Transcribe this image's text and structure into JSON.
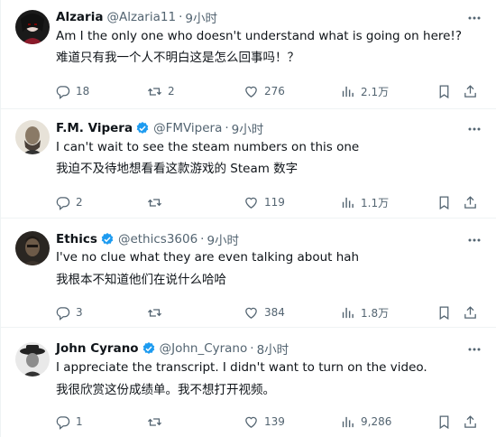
{
  "tweets": [
    {
      "name": "Alzaria",
      "handle": "@Alzaria11",
      "dot": "·",
      "time": "9小时",
      "verified": false,
      "line1": "Am I the only one who doesn't understand what is going on here!?",
      "line2": "难道只有我一个人不明白这是怎么回事吗！？",
      "replies": "18",
      "retweets": "2",
      "likes": "276",
      "views": "2.1万"
    },
    {
      "name": "F.M. Vipera",
      "handle": "@FMVipera",
      "dot": "·",
      "time": "9小时",
      "verified": true,
      "line1": "I can't wait to see the steam numbers on this one",
      "line2": "我迫不及待地想看看这款游戏的 Steam 数字",
      "replies": "2",
      "retweets": "",
      "likes": "119",
      "views": "1.1万"
    },
    {
      "name": "Ethics",
      "handle": "@ethics3606",
      "dot": "·",
      "time": "9小时",
      "verified": true,
      "line1": "I've no clue what they are even talking about hah",
      "line2": "我根本不知道他们在说什么哈哈",
      "replies": "3",
      "retweets": "",
      "likes": "384",
      "views": "1.8万"
    },
    {
      "name": "John Cyrano",
      "handle": "@John_Cyrano",
      "dot": "·",
      "time": "8小时",
      "verified": true,
      "line1": "I appreciate the transcript.  I didn't want to turn on the video.",
      "line2": "我很欣赏这份成绩单。我不想打开视频。",
      "replies": "1",
      "retweets": "",
      "likes": "139",
      "views": "9,286"
    }
  ],
  "colors": {
    "text": "#0f1419",
    "secondary": "#536471",
    "verified": "#1d9bf0",
    "border": "#eff3f4"
  },
  "icons": [
    "reply-icon",
    "retweet-icon",
    "like-icon",
    "views-icon",
    "bookmark-icon",
    "share-icon",
    "more-icon",
    "verified-badge-icon"
  ]
}
